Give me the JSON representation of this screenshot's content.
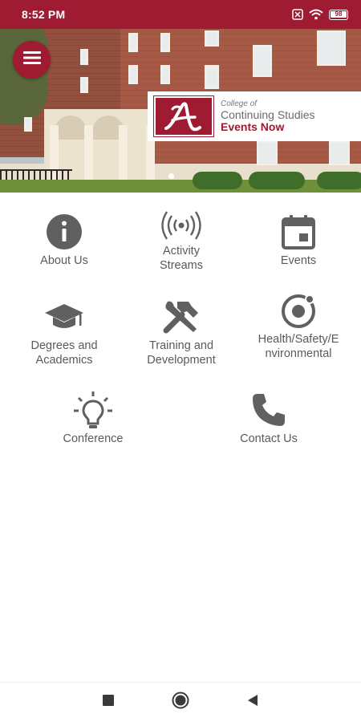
{
  "status_bar": {
    "time": "8:52 PM",
    "battery": "98",
    "icons": [
      "screenshot-icon",
      "wifi-icon",
      "battery-icon"
    ]
  },
  "hero": {
    "menu_icon": "hamburger-menu-icon",
    "logo": {
      "letter": "A",
      "line1": "College of",
      "line2": "Continuing Studies",
      "line3": "Events Now"
    },
    "carousel_dots": 2,
    "active_dot": 0
  },
  "tiles": [
    {
      "label": "About Us",
      "icon": "info-icon"
    },
    {
      "label": "Activity Streams",
      "icon": "broadcast-icon"
    },
    {
      "label": "Events",
      "icon": "calendar-icon"
    },
    {
      "label": "Degrees and Academics",
      "icon": "graduation-cap-icon"
    },
    {
      "label": "Training and Development",
      "icon": "tools-icon"
    },
    {
      "label": "Health/Safety/Environmental",
      "icon": "ionic-icon"
    },
    {
      "label": "Conference",
      "icon": "lightbulb-icon"
    },
    {
      "label": "Contact Us",
      "icon": "phone-icon"
    }
  ],
  "nav_bar": {
    "buttons": [
      "recent-apps-icon",
      "home-icon",
      "back-icon"
    ]
  },
  "colors": {
    "brand": "#9e1b32",
    "icon_gray": "#606060",
    "text_gray": "#5a5a5a"
  }
}
